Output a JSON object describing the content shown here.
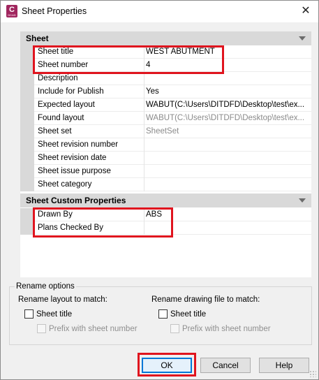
{
  "window": {
    "title": "Sheet Properties",
    "app_icon_letter": "C",
    "app_icon_sub": "DCAD",
    "close_glyph": "✕"
  },
  "sections": [
    {
      "title": "Sheet",
      "rows": [
        {
          "name": "Sheet title",
          "value": "WEST ABUTMENT",
          "dim": false
        },
        {
          "name": "Sheet number",
          "value": "4",
          "dim": false
        },
        {
          "name": "Description",
          "value": "",
          "dim": false
        },
        {
          "name": "Include for Publish",
          "value": "Yes",
          "dim": false
        },
        {
          "name": "Expected layout",
          "value": "WABUT(C:\\Users\\DITDFD\\Desktop\\test\\ex...",
          "dim": false
        },
        {
          "name": "Found layout",
          "value": "WABUT(C:\\Users\\DITDFD\\Desktop\\test\\ex...",
          "dim": true
        },
        {
          "name": "Sheet set",
          "value": "SheetSet",
          "dim": true
        },
        {
          "name": "Sheet revision number",
          "value": "",
          "dim": false
        },
        {
          "name": "Sheet revision date",
          "value": "",
          "dim": false
        },
        {
          "name": "Sheet issue purpose",
          "value": "",
          "dim": false
        },
        {
          "name": "Sheet category",
          "value": "",
          "dim": false
        }
      ]
    },
    {
      "title": "Sheet Custom Properties",
      "rows": [
        {
          "name": "Drawn By",
          "value": "ABS",
          "dim": false
        },
        {
          "name": "Plans Checked By",
          "value": "",
          "dim": false
        }
      ]
    }
  ],
  "rename": {
    "legend": "Rename options",
    "layout_label": "Rename layout to match:",
    "drawing_label": "Rename drawing file to match:",
    "sheet_title_label": "Sheet title",
    "prefix_label": "Prefix with sheet number"
  },
  "buttons": {
    "ok": "OK",
    "cancel": "Cancel",
    "help": "Help"
  },
  "colors": {
    "highlight": "#e0141e",
    "app_icon": "#a0265e",
    "default_button_border": "#0078d7"
  }
}
